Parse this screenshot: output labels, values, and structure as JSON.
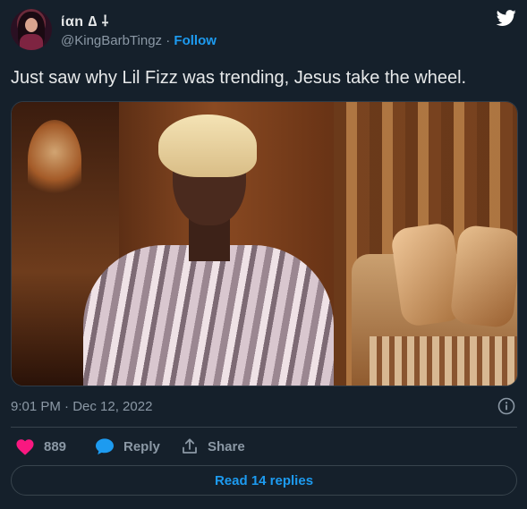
{
  "author": {
    "display_name": "ίαn ∆ ⸸",
    "handle": "@KingBarbTingz",
    "separator": "·",
    "follow_label": "Follow"
  },
  "tweet": {
    "text": "Just saw why Lil Fizz was trending, Jesus take the wheel.",
    "timestamp": "9:01 PM · Dec 12, 2022"
  },
  "actions": {
    "like_count": "889",
    "reply_label": "Reply",
    "share_label": "Share"
  },
  "read_replies_label": "Read 14 replies",
  "colors": {
    "background": "#15202b",
    "accent": "#1d9bf0",
    "like": "#f91880",
    "secondary_text": "#8b98a5"
  },
  "icons": {
    "brand": "twitter-bird-icon",
    "info": "info-icon",
    "like": "heart-icon",
    "reply": "speech-bubble-icon",
    "share": "share-upload-icon"
  }
}
